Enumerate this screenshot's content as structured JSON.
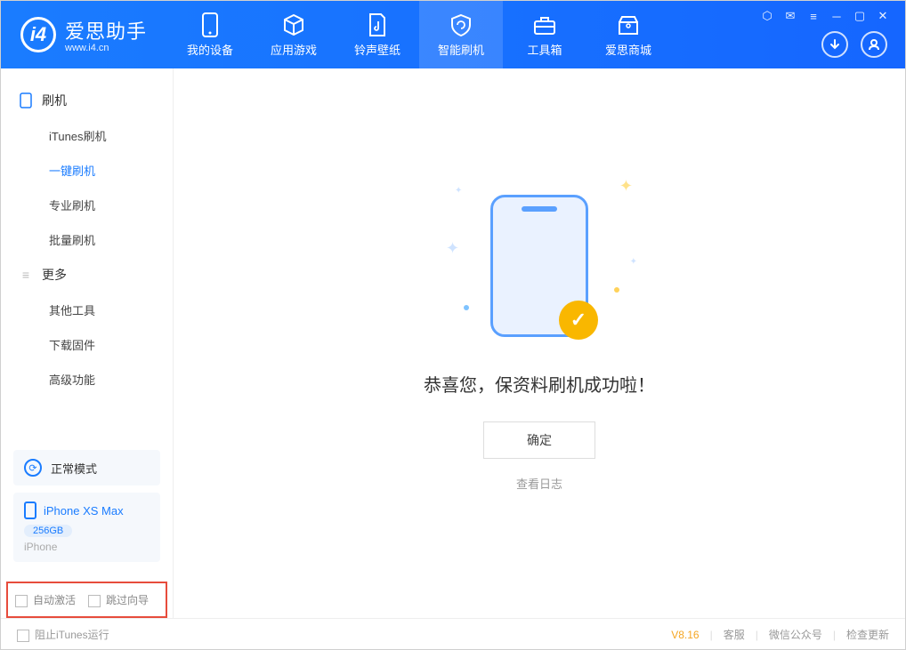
{
  "app": {
    "name_cn": "爱思助手",
    "name_en": "www.i4.cn"
  },
  "tabs": [
    {
      "label": "我的设备"
    },
    {
      "label": "应用游戏"
    },
    {
      "label": "铃声壁纸"
    },
    {
      "label": "智能刷机"
    },
    {
      "label": "工具箱"
    },
    {
      "label": "爱思商城"
    }
  ],
  "sidebar": {
    "group1": "刷机",
    "group1_items": [
      "iTunes刷机",
      "一键刷机",
      "专业刷机",
      "批量刷机"
    ],
    "group2": "更多",
    "group2_items": [
      "其他工具",
      "下载固件",
      "高级功能"
    ]
  },
  "mode": {
    "label": "正常模式"
  },
  "device": {
    "name": "iPhone XS Max",
    "capacity": "256GB",
    "type": "iPhone"
  },
  "options": {
    "auto_activate": "自动激活",
    "skip_guide": "跳过向导"
  },
  "main": {
    "success_text": "恭喜您，保资料刷机成功啦！",
    "ok": "确定",
    "view_log": "查看日志"
  },
  "footer": {
    "block_itunes": "阻止iTunes运行",
    "version": "V8.16",
    "support": "客服",
    "wechat": "微信公众号",
    "update": "检查更新"
  }
}
